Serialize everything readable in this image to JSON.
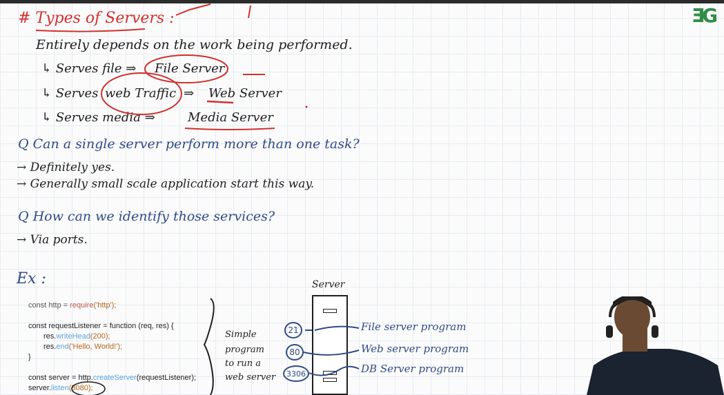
{
  "notes": {
    "title": "# Types of Servers :",
    "line1": "Entirely depends on the work being performed.",
    "bullet1_a": "↳ Serves file ⇒",
    "bullet1_b": "File Server",
    "bullet2_a": "↳ Serves",
    "bullet2_b": "web Traffic",
    "bullet2_c": "⇒",
    "bullet2_d": "Web Server",
    "bullet3_a": "↳ Serves media ⇒",
    "bullet3_b": "Media Server",
    "q1": "Q Can a single server perform more than one task?",
    "a1": "→ Definitely yes.",
    "a2": "→ Generally small scale application start this way.",
    "q2": "Q How can we identify those services?",
    "a3": "→ Via ports.",
    "ex": "Ex :"
  },
  "code": {
    "l1_kw": "const http = ",
    "l1_fn": "require",
    "l1_arg": "('http');",
    "l2": "const requestListener = function (req, res) {",
    "l3_a": "res.",
    "l3_fn": "writeHead",
    "l3_b": "(200);",
    "l4_a": "res.",
    "l4_fn": "end",
    "l4_b": "('Hello, World!');",
    "l5": "}",
    "l6_a": "const server = http.",
    "l6_fn": "createServer",
    "l6_b": "(requestListener);",
    "l7_a": "server.",
    "l7_fn": "listen",
    "l7_b": "(8080);"
  },
  "diagram": {
    "brace_label_1": "Simple",
    "brace_label_2": "program",
    "brace_label_3": "to run a",
    "brace_label_4": "web server",
    "server_label": "Server",
    "port1": "21",
    "port2": "80",
    "port3": "3306",
    "prog1": "File server program",
    "prog2": "Web server program",
    "prog3": "DB Server program"
  },
  "brand": {
    "logo": "ƎG",
    "color": "#2f8d46"
  },
  "colors": {
    "ink_black": "#1e1e1e",
    "ink_blue": "#2e4a86",
    "ink_red": "#d0302c"
  }
}
